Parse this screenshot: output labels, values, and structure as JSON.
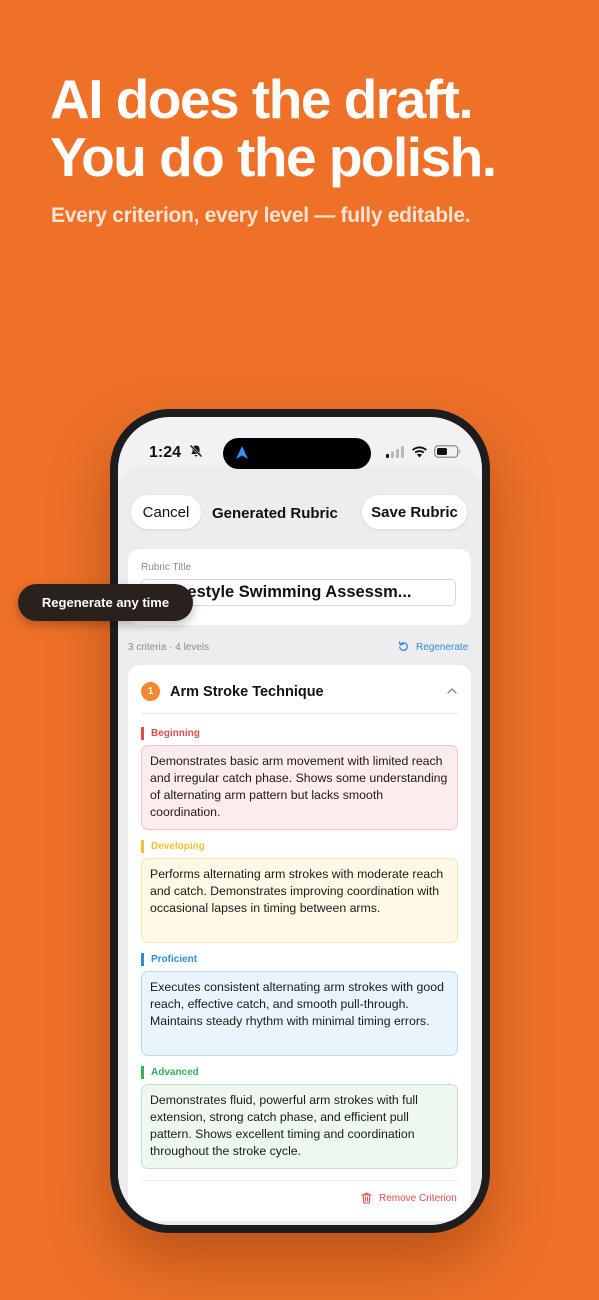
{
  "promo": {
    "headline_line1": "AI does the draft.",
    "headline_line2": "You do the polish.",
    "subline": "Every criterion, every level — fully editable."
  },
  "status_bar": {
    "time": "1:24"
  },
  "nav": {
    "cancel_label": "Cancel",
    "title": "Generated Rubric",
    "save_label": "Save Rubric"
  },
  "rubric": {
    "title_label": "Rubric Title",
    "title_value": "6 Freestyle Swimming Assessm...",
    "meta": "3 criteria · 4 levels",
    "regenerate_label": "Regenerate"
  },
  "tooltip": "Regenerate any time",
  "criterion": {
    "number": "1",
    "name": "Arm Stroke Technique",
    "remove_label": "Remove Criterion",
    "levels": [
      {
        "label": "Beginning",
        "text": "Demonstrates basic arm movement with limited reach and irregular catch phase. Shows some understanding of alternating arm pattern but lacks smooth coordination."
      },
      {
        "label": "Developing",
        "text": "Performs alternating arm strokes with moderate reach and catch. Demonstrates improving coordination with occasional lapses in timing between arms."
      },
      {
        "label": "Proficient",
        "text": "Executes consistent alternating arm strokes with good reach, effective catch, and smooth pull-through. Maintains steady rhythm with minimal timing errors."
      },
      {
        "label": "Advanced",
        "text": "Demonstrates fluid, powerful arm strokes with full extension, strong catch phase, and efficient pull pattern. Shows excellent timing and coordination throughout the stroke cycle."
      }
    ]
  },
  "colors": {
    "background": "#EE7127",
    "accent_blue": "#2C8FD6",
    "danger": "#E5484D",
    "beginning": "#E04B4B",
    "developing": "#F2C230",
    "proficient": "#2C8FD6",
    "advanced": "#2FB45A"
  },
  "icons": [
    "bell-slash-icon",
    "navigation-arrow-icon",
    "cellular-signal-icon",
    "wifi-icon",
    "battery-icon",
    "refresh-icon",
    "chevron-up-icon",
    "trash-icon"
  ]
}
